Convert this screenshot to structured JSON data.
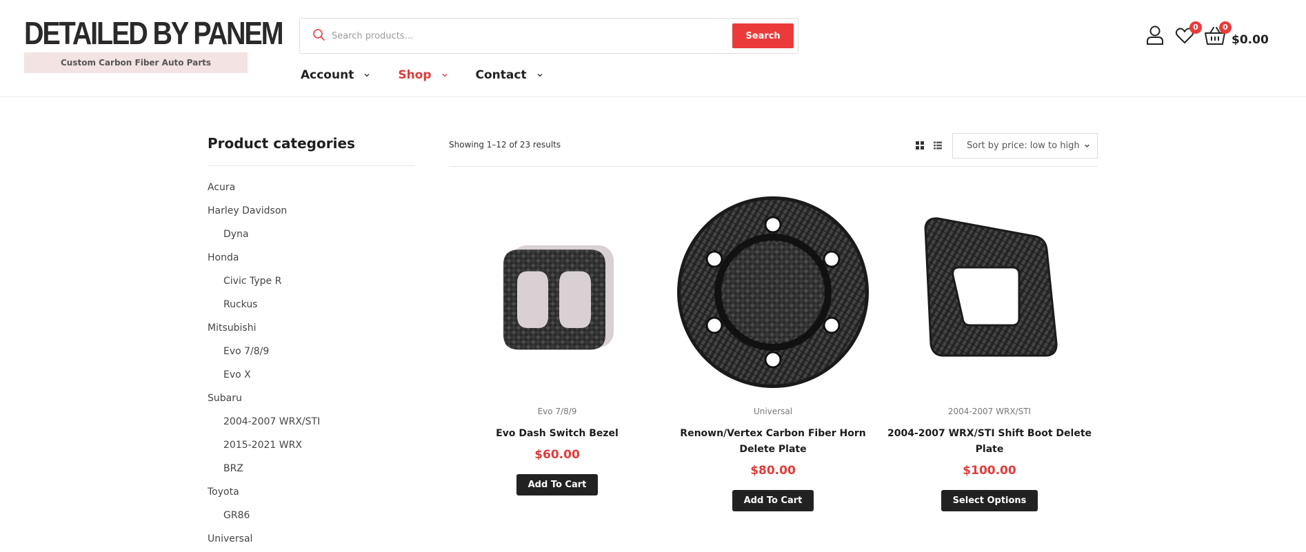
{
  "brand": {
    "name": "DETAILED BY PANEM",
    "tagline": "Custom Carbon Fiber Auto Parts"
  },
  "search": {
    "placeholder": "Search products…",
    "button_label": "Search"
  },
  "nav": [
    {
      "label": "Account",
      "active": false
    },
    {
      "label": "Shop",
      "active": true
    },
    {
      "label": "Contact",
      "active": false
    }
  ],
  "header_icons": {
    "account_icon": "user-icon",
    "wishlist_icon": "heart-icon",
    "wishlist_count": "0",
    "cart_icon": "basket-icon",
    "cart_count": "0",
    "cart_total": "$0.00"
  },
  "sidebar": {
    "title": "Product categories",
    "categories": [
      {
        "label": "Acura",
        "level": 0
      },
      {
        "label": "Harley Davidson",
        "level": 0
      },
      {
        "label": "Dyna",
        "level": 1
      },
      {
        "label": "Honda",
        "level": 0
      },
      {
        "label": "Civic Type R",
        "level": 1
      },
      {
        "label": "Ruckus",
        "level": 1
      },
      {
        "label": "Mitsubishi",
        "level": 0
      },
      {
        "label": "Evo 7/8/9",
        "level": 1
      },
      {
        "label": "Evo X",
        "level": 1
      },
      {
        "label": "Subaru",
        "level": 0
      },
      {
        "label": "2004-2007 WRX/STI",
        "level": 1
      },
      {
        "label": "2015-2021 WRX",
        "level": 1
      },
      {
        "label": "BRZ",
        "level": 1
      },
      {
        "label": "Toyota",
        "level": 0
      },
      {
        "label": "GR86",
        "level": 1
      },
      {
        "label": "Universal",
        "level": 0
      }
    ]
  },
  "toolbar": {
    "results_text": "Showing 1–12 of 23 results",
    "sort_label": "Sort by price: low to high",
    "grid_view_icon": "grid-view-icon",
    "list_view_icon": "list-view-icon"
  },
  "products": [
    {
      "category": "Evo 7/8/9",
      "title": "Evo Dash Switch Bezel",
      "price": "$60.00",
      "button": "Add To Cart"
    },
    {
      "category": "Universal",
      "title": "Renown/Vertex Carbon Fiber Horn Delete Plate",
      "price": "$80.00",
      "button": "Add To Cart"
    },
    {
      "category": "2004-2007 WRX/STI",
      "title": "2004-2007 WRX/STI Shift Boot Delete Plate",
      "price": "$100.00",
      "button": "Select Options"
    }
  ],
  "colors": {
    "accent": "#eb3a3a",
    "text_dark": "#222222",
    "tagline_bg": "#f4e3e3"
  }
}
